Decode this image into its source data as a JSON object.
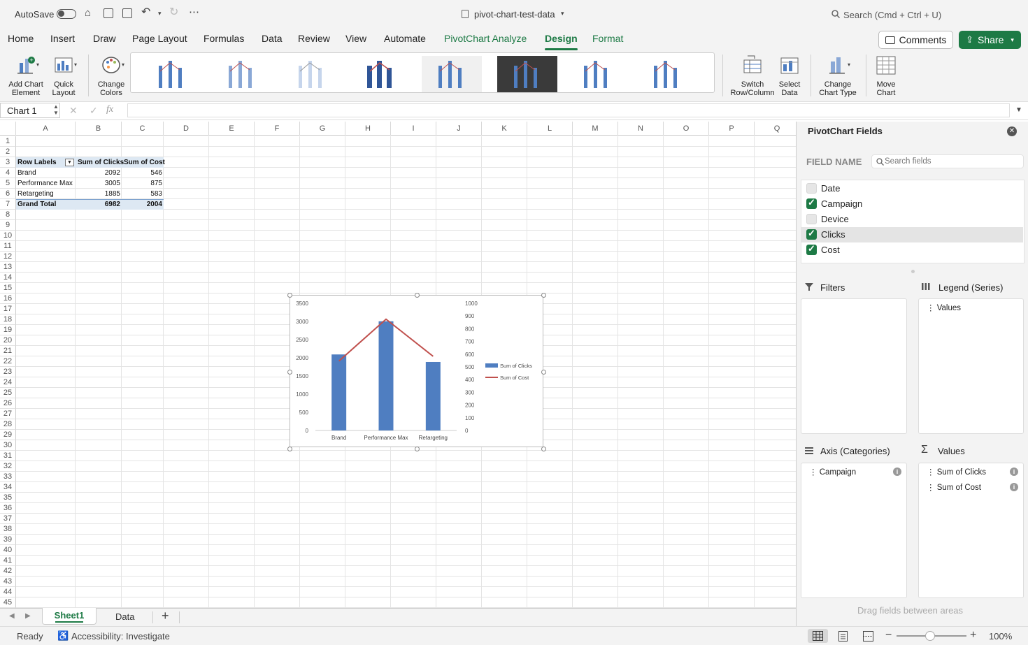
{
  "titlebar": {
    "autosave_label": "AutoSave",
    "doc_title": "pivot-chart-test-data",
    "search_placeholder": "Search (Cmd + Ctrl + U)"
  },
  "tabs": [
    "Home",
    "Insert",
    "Draw",
    "Page Layout",
    "Formulas",
    "Data",
    "Review",
    "View",
    "Automate",
    "PivotChart Analyze",
    "Design",
    "Format"
  ],
  "active_tab": "Design",
  "buttons": {
    "comments": "Comments",
    "share": "Share"
  },
  "ribbon": {
    "add_chart_element": [
      "Add Chart",
      "Element"
    ],
    "quick_layout": [
      "Quick",
      "Layout"
    ],
    "change_colors": [
      "Change",
      "Colors"
    ],
    "switch_row_column": [
      "Switch",
      "Row/Column"
    ],
    "select_data": [
      "Select",
      "Data"
    ],
    "change_chart_type": [
      "Change",
      "Chart Type"
    ],
    "move_chart": [
      "Move",
      "Chart"
    ]
  },
  "formula_bar": {
    "name_box": "Chart 1",
    "fx": "fx",
    "value": ""
  },
  "sheet": {
    "columns": [
      "A",
      "B",
      "C",
      "D",
      "E",
      "F",
      "G",
      "H",
      "I",
      "J",
      "K",
      "L",
      "M",
      "N",
      "O",
      "P",
      "Q"
    ],
    "row_count": 45,
    "pivot_table": {
      "headers": [
        "Row Labels",
        "Sum of Clicks",
        "Sum of Cost"
      ],
      "rows": [
        [
          "Brand",
          "2092",
          "546"
        ],
        [
          "Performance Max",
          "3005",
          "875"
        ],
        [
          "Retargeting",
          "1885",
          "583"
        ]
      ],
      "total": [
        "Grand Total",
        "6982",
        "2004"
      ]
    }
  },
  "chart_data": {
    "type": "bar",
    "categories": [
      "Brand",
      "Performance Max",
      "Retargeting"
    ],
    "series": [
      {
        "name": "Sum of Clicks",
        "type": "bar",
        "axis": "left",
        "values": [
          2092,
          3005,
          1885
        ],
        "color": "#4f7ec1"
      },
      {
        "name": "Sum of Cost",
        "type": "line",
        "axis": "right",
        "values": [
          546,
          875,
          583
        ],
        "color": "#c0504d"
      }
    ],
    "y_left": {
      "min": 0,
      "max": 3500,
      "ticks": [
        0,
        500,
        1000,
        1500,
        2000,
        2500,
        3000,
        3500
      ]
    },
    "y_right": {
      "min": 0,
      "max": 1000,
      "ticks": [
        0,
        100,
        200,
        300,
        400,
        500,
        600,
        700,
        800,
        900,
        1000
      ]
    },
    "legend_position": "right",
    "grid": false
  },
  "pivot_panel": {
    "title": "PivotChart Fields",
    "field_name_label": "FIELD NAME",
    "search_placeholder": "Search fields",
    "fields": [
      {
        "name": "Date",
        "checked": false
      },
      {
        "name": "Campaign",
        "checked": true
      },
      {
        "name": "Device",
        "checked": false
      },
      {
        "name": "Clicks",
        "checked": true
      },
      {
        "name": "Cost",
        "checked": true
      }
    ],
    "filters_label": "Filters",
    "legend_label": "Legend (Series)",
    "legend_items": [
      "Values"
    ],
    "axis_label": "Axis (Categories)",
    "axis_items": [
      "Campaign"
    ],
    "values_label": "Values",
    "values_items": [
      "Sum of Clicks",
      "Sum of Cost"
    ],
    "drag_hint": "Drag fields between areas"
  },
  "sheet_tabs": [
    "Sheet1",
    "Data"
  ],
  "status": {
    "ready": "Ready",
    "accessibility": "Accessibility: Investigate",
    "zoom": "100%"
  },
  "colors": {
    "accent": "#1d7a45",
    "bar": "#4f7ec1",
    "line": "#c0504d"
  }
}
